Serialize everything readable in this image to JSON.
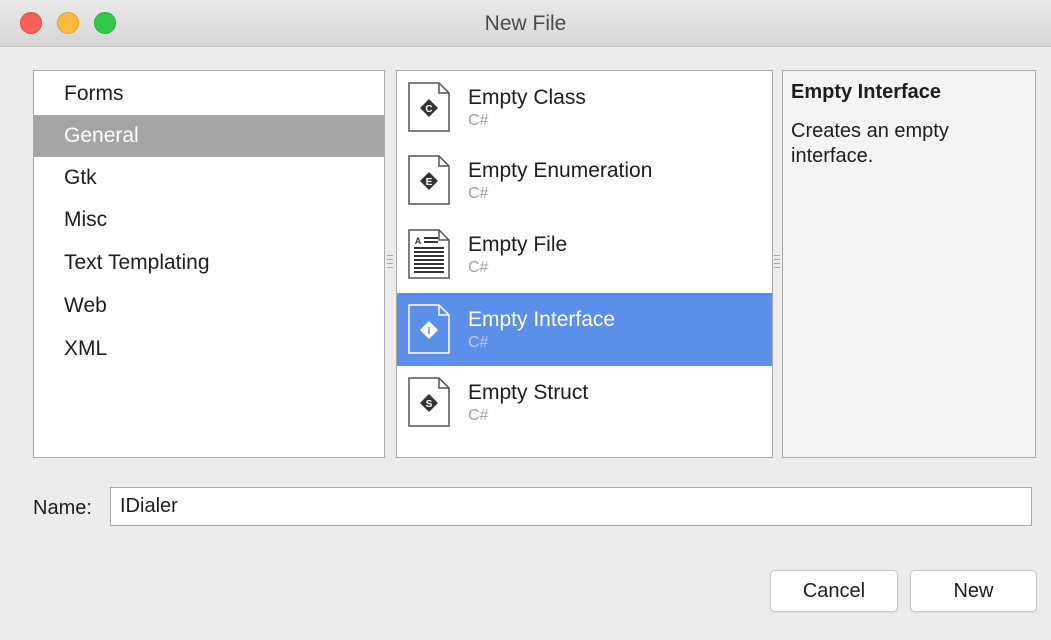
{
  "window": {
    "title": "New File"
  },
  "categories": [
    {
      "label": "Forms",
      "selected": false
    },
    {
      "label": "General",
      "selected": true
    },
    {
      "label": "Gtk",
      "selected": false
    },
    {
      "label": "Misc",
      "selected": false
    },
    {
      "label": "Text Templating",
      "selected": false
    },
    {
      "label": "Web",
      "selected": false
    },
    {
      "label": "XML",
      "selected": false
    }
  ],
  "templates": [
    {
      "name": "Empty Class",
      "lang": "C#",
      "icon": "class-icon",
      "letter": "C",
      "selected": false
    },
    {
      "name": "Empty Enumeration",
      "lang": "C#",
      "icon": "enum-icon",
      "letter": "E",
      "selected": false
    },
    {
      "name": "Empty File",
      "lang": "C#",
      "icon": "file-icon",
      "letter": "",
      "selected": false
    },
    {
      "name": "Empty Interface",
      "lang": "C#",
      "icon": "interface-icon",
      "letter": "I",
      "selected": true
    },
    {
      "name": "Empty Struct",
      "lang": "C#",
      "icon": "struct-icon",
      "letter": "S",
      "selected": false
    }
  ],
  "description": {
    "title": "Empty Interface",
    "text": "Creates an empty interface."
  },
  "name_field": {
    "label": "Name:",
    "value": "IDialer"
  },
  "buttons": {
    "cancel": "Cancel",
    "new": "New"
  },
  "colors": {
    "selection_blue": "#5b8fe9",
    "category_selection": "#a5a5a5"
  }
}
